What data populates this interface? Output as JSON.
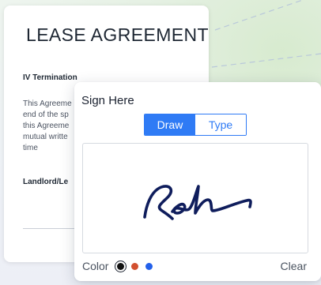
{
  "document": {
    "title": "LEASE AGREEMENT",
    "section_heading": "IV Termination",
    "paragraph_lines": [
      "This Agreeme",
      "end of the sp",
      "this Agreeme",
      "mutual writte",
      "time"
    ],
    "signature_label": "Landlord/Le"
  },
  "signature_dialog": {
    "title": "Sign Here",
    "tabs": [
      {
        "label": "Draw",
        "active": true
      },
      {
        "label": "Type",
        "active": false
      }
    ],
    "ink_color": "#0f1d5c",
    "color_label": "Color",
    "colors": [
      {
        "name": "black",
        "hex": "#111111",
        "selected": true
      },
      {
        "name": "red",
        "hex": "#d2502f",
        "selected": false
      },
      {
        "name": "blue",
        "hex": "#2360ea",
        "selected": false
      }
    ],
    "clear_label": "Clear"
  },
  "theme": {
    "accent": "#2f7bf5"
  }
}
